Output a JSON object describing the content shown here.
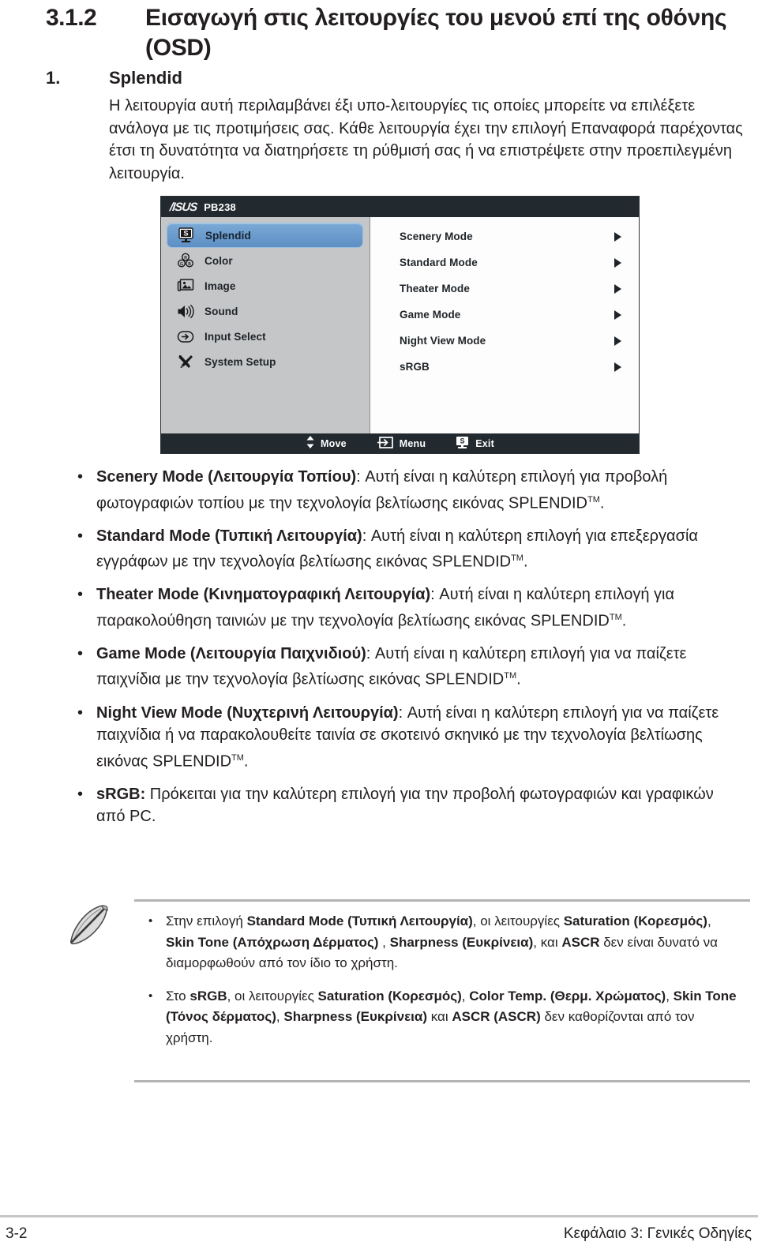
{
  "heading": {
    "number": "3.1.2",
    "title": "Εισαγωγή στις λειτουργίες του μενού επί της οθόνης (OSD)"
  },
  "subheading": {
    "number": "1.",
    "title": "Splendid"
  },
  "intro": "Η λειτουργία αυτή περιλαμβάνει έξι υπο-λειτουργίες τις οποίες μπορείτε να επιλέξετε ανάλογα με τις προτιμήσεις σας. Κάθε λειτουργία έχει την επιλογή Επαναφορά παρέχοντας έτσι τη δυνατότητα να διατηρήσετε τη ρύθμισή σας ή να επιστρέψετε στην προεπιλεγμένη λειτουργία.",
  "osd": {
    "brand": "/ISUS",
    "model": "PB238",
    "colors": {
      "titlebar": "#222a2f",
      "sidebar": "#c5c6c8",
      "panel": "#fdfdfd",
      "highlight": "#5e8fc4"
    },
    "menu_items": [
      {
        "label": "Splendid",
        "icon": "splendid-monitor-icon",
        "selected": true
      },
      {
        "label": "Color",
        "icon": "color-palette-icon",
        "selected": false
      },
      {
        "label": "Image",
        "icon": "image-picture-icon",
        "selected": false
      },
      {
        "label": "Sound",
        "icon": "speaker-icon",
        "selected": false
      },
      {
        "label": "Input Select",
        "icon": "input-arrow-icon",
        "selected": false
      },
      {
        "label": "System Setup",
        "icon": "tools-wrench-screwdriver-icon",
        "selected": false
      }
    ],
    "options": [
      {
        "label": "Scenery Mode"
      },
      {
        "label": "Standard Mode"
      },
      {
        "label": "Theater Mode"
      },
      {
        "label": "Game Mode"
      },
      {
        "label": "Night View Mode"
      },
      {
        "label": "sRGB"
      }
    ],
    "footer": [
      {
        "label": "Move",
        "icon": "up-down-arrows-icon"
      },
      {
        "label": "Menu",
        "icon": "menu-enter-icon"
      },
      {
        "label": "Exit",
        "icon": "splendid-s-icon"
      }
    ]
  },
  "bullets": [
    {
      "bold": "Scenery Mode (Λειτουργία Τοπίου)",
      "rest": ": Αυτή είναι η καλύτερη επιλογή για προβολή φωτογραφιών τοπίου με την τεχνολογία βελτίωσης εικόνας SPLENDID",
      "tm": "TM",
      "tail": "."
    },
    {
      "bold": "Standard Mode (Τυπική Λειτουργία)",
      "rest": ": Αυτή είναι η καλύτερη επιλογή για επεξεργασία εγγράφων με την τεχνολογία βελτίωσης εικόνας SPLENDID",
      "tm": "TM",
      "tail": "."
    },
    {
      "bold": "Theater Mode (Κινηματογραφική Λειτουργία)",
      "rest": ": Αυτή είναι η καλύτερη επιλογή για παρακολούθηση ταινιών με την τεχνολογία βελτίωσης εικόνας SPLENDID",
      "tm": "TM",
      "tail": "."
    },
    {
      "bold": "Game Mode (Λειτουργία Παιχνιδιού)",
      "rest": ": Αυτή είναι η καλύτερη επιλογή για να παίζετε παιχνίδια με την τεχνολογία βελτίωσης εικόνας SPLENDID",
      "tm": "TM",
      "tail": "."
    },
    {
      "bold": "Night View Mode (Νυχτερινή Λειτουργία)",
      "rest": ": Αυτή είναι η καλύτερη επιλογή για να παίζετε παιχνίδια ή να παρακολουθείτε ταινία σε σκοτεινό σκηνικό με την τεχνολογία βελτίωσης εικόνας SPLENDID",
      "tm": "TM",
      "tail": "."
    },
    {
      "bold": "sRGB:",
      "rest": " Πρόκειται για την καλύτερη επιλογή για την προβολή φωτογραφιών και γραφικών από PC.",
      "tm": "",
      "tail": ""
    }
  ],
  "note": {
    "icon": "pencil-note-icon",
    "bullets": [
      {
        "p1": "Στην επιλογή ",
        "b1": "Standard Mode (Τυπική Λειτουργία)",
        "p2": ", οι λειτουργίες ",
        "b2": "Saturation (Κορεσμός)",
        "p3": ", ",
        "b3": "Skin Tone (Απόχρωση Δέρματος)",
        "p4": " , ",
        "b4": "Sharpness (Ευκρίνεια)",
        "p5": ", και ",
        "b5": "ASCR",
        "p6": " δεν είναι δυνατό να διαμορφωθούν από τον ίδιο το χρήστη."
      },
      {
        "p1": "Στο ",
        "b1": "sRGB",
        "p2": ", οι λειτουργίες ",
        "b2": "Saturation (Κορεσμός)",
        "p3": ", ",
        "b3": "Color Temp. (Θερμ. Χρώματος)",
        "p4": ", ",
        "b4": "Skin Tone (Τόνος δέρματος)",
        "p5": ", ",
        "b5": "Sharpness (Ευκρίνεια)",
        "p6": " και ",
        "b6": "ASCR (ASCR)",
        "p7": " δεν καθορίζονται από τον χρήστη."
      }
    ]
  },
  "footer": {
    "page": "3-2",
    "chapter": "Κεφάλαιο 3: Γενικές Οδηγίες"
  }
}
